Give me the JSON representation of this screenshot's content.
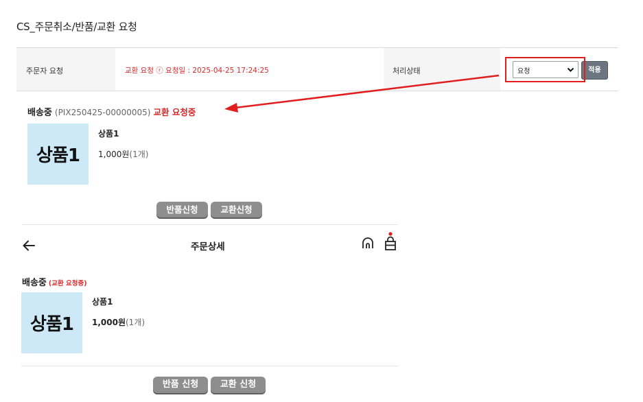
{
  "page": {
    "title": "CS_주문취소/반품/교환 요청"
  },
  "request_table": {
    "orderer_label": "주문자 요청",
    "request_info": "교환 요청 ⓡ 요청일 : 2025-04-25 17:24:25",
    "status_label": "처리상태",
    "status_select": {
      "value": "요청"
    },
    "apply_label": "적용"
  },
  "admin_order": {
    "status": "배송중",
    "order_no": "(PIX250425-00000005)",
    "exchange_status": "교환 요청중",
    "product": {
      "thumb_text": "상품1",
      "name": "상품1",
      "price": "1,000원",
      "qty": "(1개)"
    },
    "buttons": {
      "return": "반품신청",
      "exchange": "교환신청"
    }
  },
  "mobile": {
    "header_title": "주문상세",
    "status": "배송중",
    "exchange_status": "(교환 요청중)",
    "product": {
      "thumb_text": "상품1",
      "name": "상품1",
      "price": "1,000원",
      "qty": "(1개)"
    },
    "buttons": {
      "return": "반품 신청",
      "exchange": "교환 신청"
    },
    "icons": [
      "back-arrow-icon",
      "home-icon",
      "cart-icon"
    ]
  },
  "colors": {
    "accent_red": "#d52a2a",
    "highlight_red": "#e11d1d",
    "thumb_bg": "#cde9f8",
    "button_gray": "#8e8e8e",
    "apply_gray": "#6b7680"
  }
}
